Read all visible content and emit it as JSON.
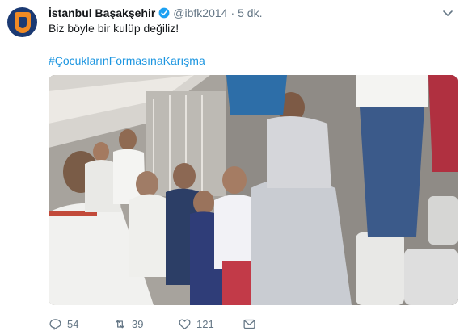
{
  "tweet": {
    "author_name": "İstanbul Başakşehir",
    "handle": "@ibfk2014",
    "separator": "·",
    "time": "5 dk.",
    "text": "Biz böyle bir kulüp değiliz!",
    "hashtag": "#ÇocuklarınFormasınaKarışma"
  },
  "actions": {
    "replies": "54",
    "retweets": "39",
    "likes": "121"
  },
  "colors": {
    "brand_navy": "#1b3a73",
    "brand_orange": "#f08a24",
    "link_blue": "#1b95e0",
    "verified_blue": "#1da1f2",
    "muted_gray": "#657786"
  },
  "icons": [
    "team-logo",
    "verified-badge-icon",
    "chevron-down-icon",
    "reply-icon",
    "retweet-icon",
    "like-icon",
    "direct-message-icon"
  ]
}
